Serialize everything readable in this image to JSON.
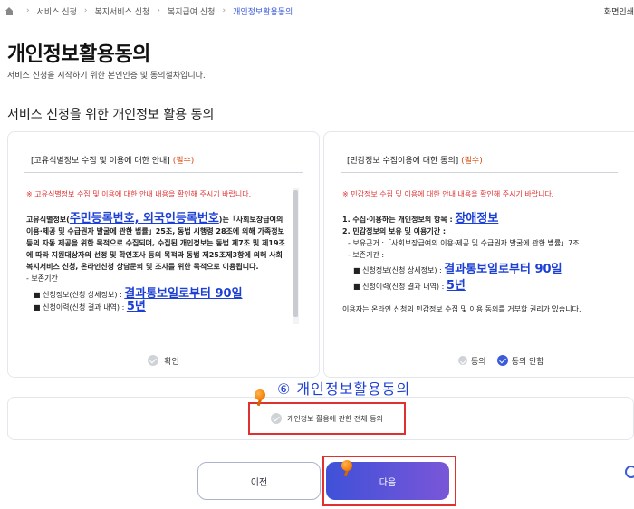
{
  "breadcrumb": {
    "items": [
      "서비스 신청",
      "복지서비스 신청",
      "복지급여 신청"
    ],
    "current": "개인정보활용동의",
    "right": "화면인쇄"
  },
  "page": {
    "title": "개인정보활용동의",
    "subtitle": "서비스 신청을 시작하기 위한 본인인증 및 동의절차입니다.",
    "section_title": "서비스 신청을 위한 개인정보 활용 동의"
  },
  "left_card": {
    "title": "[고유식별정보 수집 및 이용에 대한 안내]",
    "required": "(필수)",
    "warning": "※ 고유식별정보 수집 및 이용에 대한 안내 내용을 확인해 주시기 바랍니다.",
    "p1_pre": "고유식별정보(",
    "p1_link": "주민등록번호, 외국인등록번호",
    "p1_post": ")는「사회보장급여의 이용·제공 및 수급권자 발굴에 관한 법률」25조, 동법 시행령 28조에 의해 가족정보 등의 자동 제공을 위한 목적으로 수집되며, 수집된 개인정보는 동법 제7조 및 제19조에 따라 지원대상자의 선정 및 확인조사 등의 목적과 동법 제25조제3항에 의해 사회복지서비스 신청, 온라인신청 상담문의 및 조사를 위한 목적으로 이용됩니다.",
    "retention_label": "- 보존기간",
    "retention_item": "■ 신청정보(신청 상세정보) :",
    "retention_value": "결과통보일로부터 90일",
    "retention_item2": "■ 신청이력(신청 결과 내역) :",
    "retention_value2": "5년",
    "confirm_label": "확인"
  },
  "right_card": {
    "title": "[민감정보 수집이용에 대한 동의]",
    "required": "(필수)",
    "warning": "※ 민감정보 수집 및 이용에 대한 안내 내용을 확인해 주시기 바랍니다.",
    "item1_pre": "1. 수집·이용하는 개인정보의 항목 :",
    "item1_link": "장애정보",
    "item2": "2. 민감정보의 보유 및 이용기간 :",
    "basis": "- 보유근거 :「사회보장급여의 이용·제공 및 수급권자 발굴에 관한 법률」7조",
    "retention_label": "- 보존기간 :",
    "retention_item": "■ 신청정보(신청 상세정보) :",
    "retention_value": "결과통보일로부터 90일",
    "retention_item2": "■ 신청이력(신청 결과 내역) :",
    "retention_value2": "5년",
    "notice": "이용자는 온라인 신청의 민감정보 수집 및 이용 동의를 거부할 권리가 있습니다.",
    "agree_label": "동의",
    "disagree_label": "동의 안함"
  },
  "annotation": "⑥ 개인정보활용동의",
  "all_agree_label": "개인정보 활용에 관한 전체 동의",
  "buttons": {
    "prev": "이전",
    "next": "다음"
  },
  "colors": {
    "accent": "#3b5bdb",
    "required": "#d9480f",
    "warning": "#e03131",
    "highlight": "#e03131"
  }
}
